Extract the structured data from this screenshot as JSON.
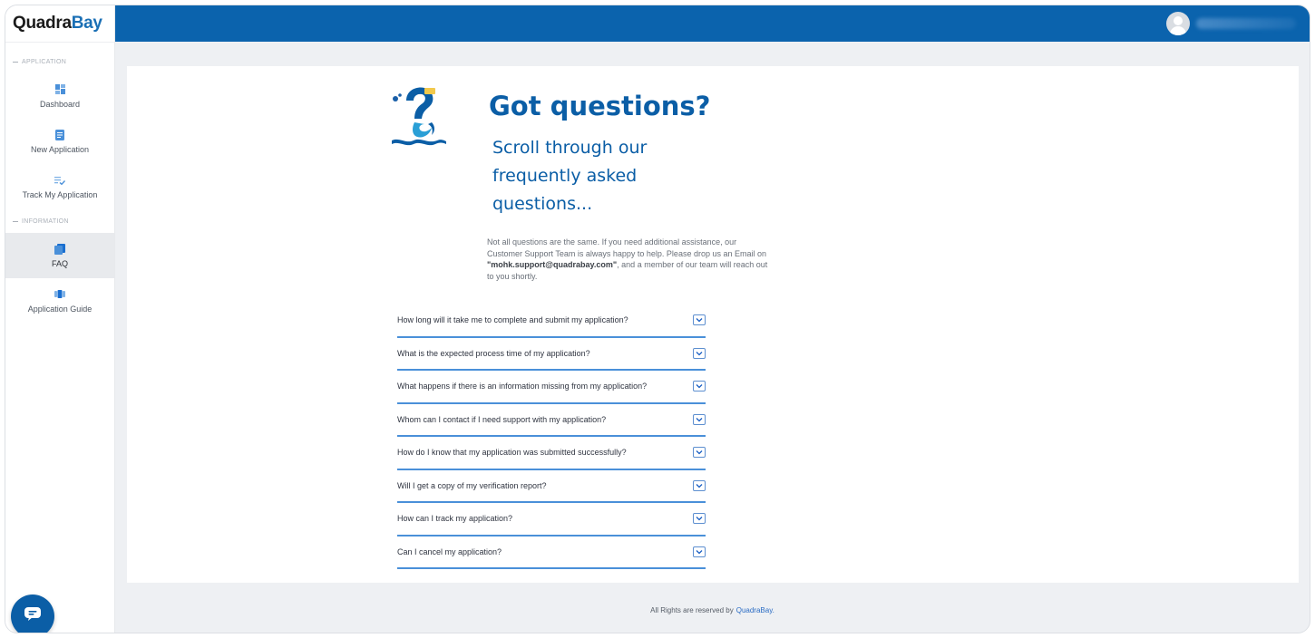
{
  "app": {
    "logo_prefix": "Quadra",
    "logo_suffix": "Bay"
  },
  "sidebar": {
    "sections": [
      {
        "label": "APPLICATION",
        "items": [
          {
            "label": "Dashboard",
            "icon": "dashboard-icon"
          },
          {
            "label": "New Application",
            "icon": "document-icon"
          },
          {
            "label": "Track My Application",
            "icon": "checklist-icon"
          }
        ]
      },
      {
        "label": "INFORMATION",
        "items": [
          {
            "label": "FAQ",
            "icon": "copy-icon",
            "active": true
          },
          {
            "label": "Application Guide",
            "icon": "guide-icon"
          }
        ]
      }
    ]
  },
  "main": {
    "title": "Got questions?",
    "subtitle_lines": [
      "Scroll through our",
      "frequently asked",
      "questions..."
    ],
    "intro_before": "Not all questions are the same. If you need additional assistance, our Customer Support Team is always happy to help. Please drop us an Email on ",
    "intro_email": "\"mohk.support@quadrabay.com\"",
    "intro_after": ", and a member of our team will reach out to you shortly.",
    "faqs": [
      "How long will it take me to complete and submit my application?",
      "What is the expected process time of my application?",
      "What happens if there is an information missing from my application?",
      "Whom can I contact if I need support with my application?",
      "How do I know that my application was submitted successfully?",
      "Will I get a copy of my verification report?",
      "How can I track my application?",
      "Can I cancel my application?"
    ]
  },
  "footer": {
    "text": "All Rights are reserved by",
    "link": "QuadraBay."
  },
  "colors": {
    "brand": "#0b63ad",
    "title": "#0b5ea6",
    "faq_rule": "#4a90d9"
  }
}
